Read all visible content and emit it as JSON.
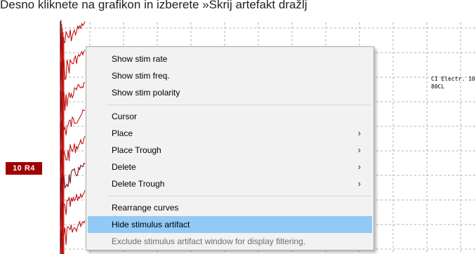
{
  "caption": "Desno kliknete na grafikon in izberete »Skrij artefakt dražlj",
  "curve_label": "10  R4",
  "electrode_info": {
    "line1": "CI Electr. 10",
    "line2": "80CL"
  },
  "colors": {
    "curve": "#c00000",
    "curve_dark": "#700000",
    "label_bg": "#a00000",
    "menu_bg": "#f2f2f2",
    "highlight": "#91c9f7",
    "grid": "#b0b0b0"
  },
  "context_menu": {
    "groups": [
      [
        {
          "label": "Show stim rate",
          "submenu": false,
          "state": "normal"
        },
        {
          "label": "Show stim freq.",
          "submenu": false,
          "state": "normal"
        },
        {
          "label": "Show stim polarity",
          "submenu": false,
          "state": "normal"
        }
      ],
      [
        {
          "label": "Cursor",
          "submenu": false,
          "state": "normal"
        },
        {
          "label": "Place",
          "submenu": true,
          "state": "normal"
        },
        {
          "label": "Place Trough",
          "submenu": true,
          "state": "normal"
        },
        {
          "label": "Delete",
          "submenu": true,
          "state": "normal"
        },
        {
          "label": "Delete Trough",
          "submenu": true,
          "state": "normal"
        }
      ],
      [
        {
          "label": "Rearrange curves",
          "submenu": false,
          "state": "normal"
        },
        {
          "label": "Hide stimulus artifact",
          "submenu": false,
          "state": "highlighted"
        },
        {
          "label": "Exclude stimulus artifact window for display filtering.",
          "submenu": false,
          "state": "disabled"
        }
      ]
    ],
    "submenu_arrow": "›"
  }
}
